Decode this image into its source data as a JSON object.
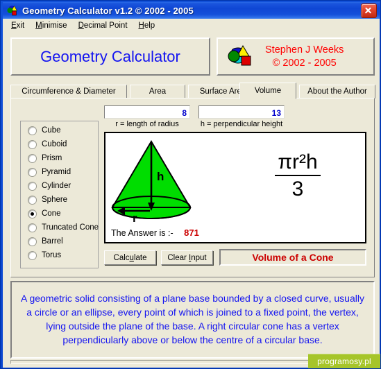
{
  "window": {
    "title": "Geometry Calculator v1.2 ©  2002 - 2005",
    "icon": "shapes-icon",
    "close_label": "close-icon"
  },
  "menu": {
    "items": [
      {
        "label": "Exit",
        "accel": "E"
      },
      {
        "label": "Minimise",
        "accel": "M"
      },
      {
        "label": "Decimal Point",
        "accel": "D"
      },
      {
        "label": "Help",
        "accel": "H"
      }
    ]
  },
  "header": {
    "app_name": "Geometry Calculator",
    "author_name": "Stephen J Weeks",
    "author_copyright": "© 2002 - 2005",
    "logo_icon": "shapes-logo-icon"
  },
  "tabs": [
    {
      "label": "Circumference & Diameter",
      "active": false
    },
    {
      "label": "Area",
      "active": false
    },
    {
      "label": "Surface Area",
      "active": false
    },
    {
      "label": "Volume",
      "active": true
    },
    {
      "label": "About the Author",
      "active": false
    }
  ],
  "shapes": {
    "selected": "Cone",
    "items": [
      {
        "label": "Cube",
        "selected": false
      },
      {
        "label": "Cuboid",
        "selected": false
      },
      {
        "label": "Prism",
        "selected": false
      },
      {
        "label": "Pyramid",
        "selected": false
      },
      {
        "label": "Cylinder",
        "selected": false
      },
      {
        "label": "Sphere",
        "selected": false
      },
      {
        "label": "Cone",
        "selected": true
      },
      {
        "label": "Truncated Cone",
        "selected": false
      },
      {
        "label": "Barrel",
        "selected": false
      },
      {
        "label": "Torus",
        "selected": false
      }
    ]
  },
  "inputs": {
    "radius": {
      "value": "8",
      "caption": "r = length of radius",
      "placeholder": ""
    },
    "height": {
      "value": "13",
      "caption": "h = perpendicular height",
      "placeholder": ""
    }
  },
  "diagram": {
    "shape_icon": "cone-diagram-icon",
    "label_height": "h",
    "label_radius": "r",
    "formula_numerator": "πr²h",
    "formula_denominator": "3",
    "answer_label": "The Answer is :-",
    "answer_value": "871"
  },
  "actions": {
    "calculate": {
      "label": "Calculate",
      "accel": "u"
    },
    "clear": {
      "label": "Clear Input",
      "accel": "I"
    }
  },
  "shape_title": "Volume of a Cone",
  "description": "A geometric solid consisting of a plane base bounded by a closed curve, usually a circle or an ellipse, every point of which is joined to a fixed point, the vertex, lying outside the plane of the base. A right circular cone has a vertex perpendicularly above or below the centre of a circular base.",
  "watermark": "programosy.pl",
  "colors": {
    "titlebar_blue": "#0F47D4",
    "panel_face": "#ECE9D8",
    "app_title_blue": "#1414F0",
    "author_red": "#FF0000",
    "shape_title_red": "#CC0000",
    "answer_red": "#CC0000",
    "cone_green": "#00DD00",
    "input_text_blue": "#0000CC",
    "watermark_green": "#A6C52A"
  }
}
